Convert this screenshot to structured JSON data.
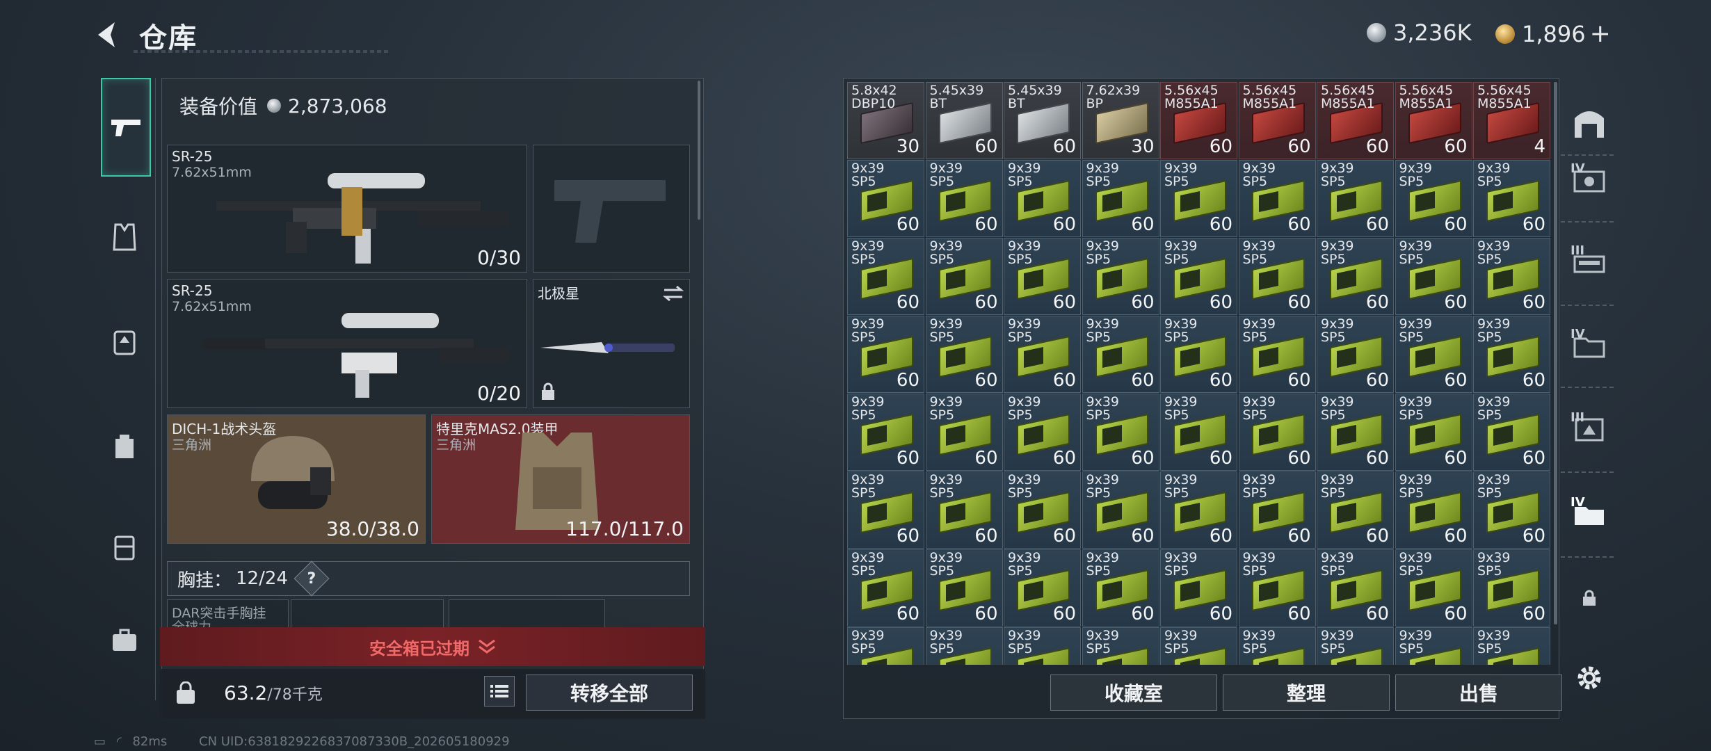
{
  "header": {
    "title": "仓库",
    "silver_amount": "3,236K",
    "gold_amount": "1,896",
    "plus": "+"
  },
  "equipment": {
    "value_label": "装备价值",
    "value": "2,873,068",
    "primary1": {
      "name": "SR-25",
      "caliber": "7.62x51mm",
      "ammo": "0/30"
    },
    "primary2": {
      "name": "SR-25",
      "caliber": "7.62x51mm",
      "ammo": "0/20"
    },
    "melee": {
      "name": "北极星"
    },
    "helmet": {
      "name": "DICH-1战术头盔",
      "brand": "三角洲",
      "durability": "38.0/38.0"
    },
    "armor": {
      "name": "特里克MAS2.0装甲",
      "brand": "三角洲",
      "durability": "117.0/117.0"
    },
    "chest_label": "胸挂：",
    "chest_count": "12",
    "chest_total": "/24",
    "chest_item": "DAR突击手胸挂",
    "chest_item_sub": "全球力",
    "help": "?",
    "expired": "安全箱已过期",
    "weight": "63.2",
    "weight_max": "/78千克",
    "transfer_all": "转移全部"
  },
  "inventory": {
    "top_row": [
      {
        "label": "5.8x42\nDBP10",
        "qty": "30",
        "style": "dark"
      },
      {
        "label": "5.45x39\nBT",
        "qty": "60",
        "style": "silver"
      },
      {
        "label": "5.45x39\nBT",
        "qty": "60",
        "style": "silver"
      },
      {
        "label": "7.62x39\nBP",
        "qty": "30",
        "style": "tan"
      },
      {
        "label": "5.56x45\nM855A1",
        "qty": "60",
        "style": "red"
      },
      {
        "label": "5.56x45\nM855A1",
        "qty": "60",
        "style": "red"
      },
      {
        "label": "5.56x45\nM855A1",
        "qty": "60",
        "style": "red"
      },
      {
        "label": "5.56x45\nM855A1",
        "qty": "60",
        "style": "red"
      },
      {
        "label": "5.56x45\nM855A1",
        "qty": "4",
        "style": "red"
      }
    ],
    "standard": {
      "label": "9x39\nSP5",
      "qty": "60"
    },
    "buttons": {
      "collection": "收藏室",
      "organize": "整理",
      "sell": "出售"
    }
  },
  "rail": [
    "IV",
    "III",
    "IV",
    "III",
    "IV"
  ],
  "status": {
    "ping": "82ms",
    "uid": "CN UID:6381829226837087330B_202605180929"
  },
  "icons": [
    "back-arrow-icon",
    "pistol-icon",
    "vest-icon",
    "backpack-icon",
    "pouch-icon",
    "case-icon",
    "toolbox-icon",
    "weight-lock-icon",
    "list-icon",
    "garage-icon",
    "lock-icon",
    "settings-icon"
  ]
}
